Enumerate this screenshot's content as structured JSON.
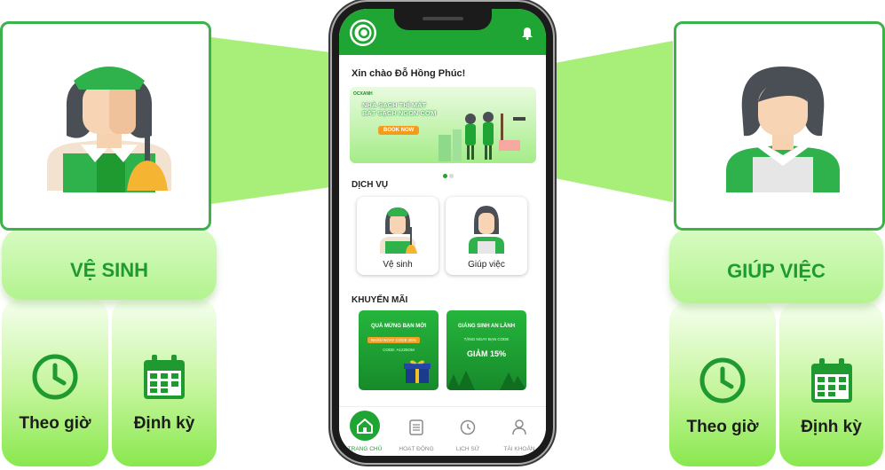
{
  "left_service": {
    "title": "VỆ SINH",
    "options": [
      {
        "label": "Theo giờ",
        "icon": "clock-icon"
      },
      {
        "label": "Định kỳ",
        "icon": "calendar-icon"
      }
    ],
    "illustration": "cleaner-with-broom"
  },
  "right_service": {
    "title": "GIÚP VIỆC",
    "options": [
      {
        "label": "Theo giờ",
        "icon": "clock-icon"
      },
      {
        "label": "Định kỳ",
        "icon": "calendar-icon"
      }
    ],
    "illustration": "housekeeper"
  },
  "app": {
    "greeting": "Xin chào Đỗ Hồng Phúc!",
    "banner": {
      "brand": "OCXANH",
      "headline_1": "NHÀ SẠCH THÌ MÁT",
      "headline_2": "BÁT SẠCH NGON CƠM",
      "button": "BOOK NOW",
      "page_count": 2,
      "active_page": 1
    },
    "services_title": "DỊCH VỤ",
    "services": [
      {
        "label": "Vệ sinh"
      },
      {
        "label": "Giúp việc"
      }
    ],
    "promos_title": "KHUYẾN MÃI",
    "promos": [
      {
        "title": "QUÀ MỪNG BẠN MỚI",
        "badge": "NHẬN NGAY CODE 25%",
        "code": "CODE: A1225OM"
      },
      {
        "title": "GIÁNG SINH AN LÀNH",
        "subtitle": "TẶNG NGAY BẠN CODE",
        "discount": "GIẢM 15%"
      }
    ],
    "nav": [
      {
        "label": "TRANG CHỦ",
        "active": true
      },
      {
        "label": "HOẠT ĐỘNG"
      },
      {
        "label": "LỊCH SỬ"
      },
      {
        "label": "TÀI KHOẢN"
      }
    ]
  },
  "colors": {
    "brand_green": "#1fa533",
    "title_green": "#1e9a30",
    "light_green": "#b3f38f",
    "accent_orange": "#f59b1c"
  }
}
